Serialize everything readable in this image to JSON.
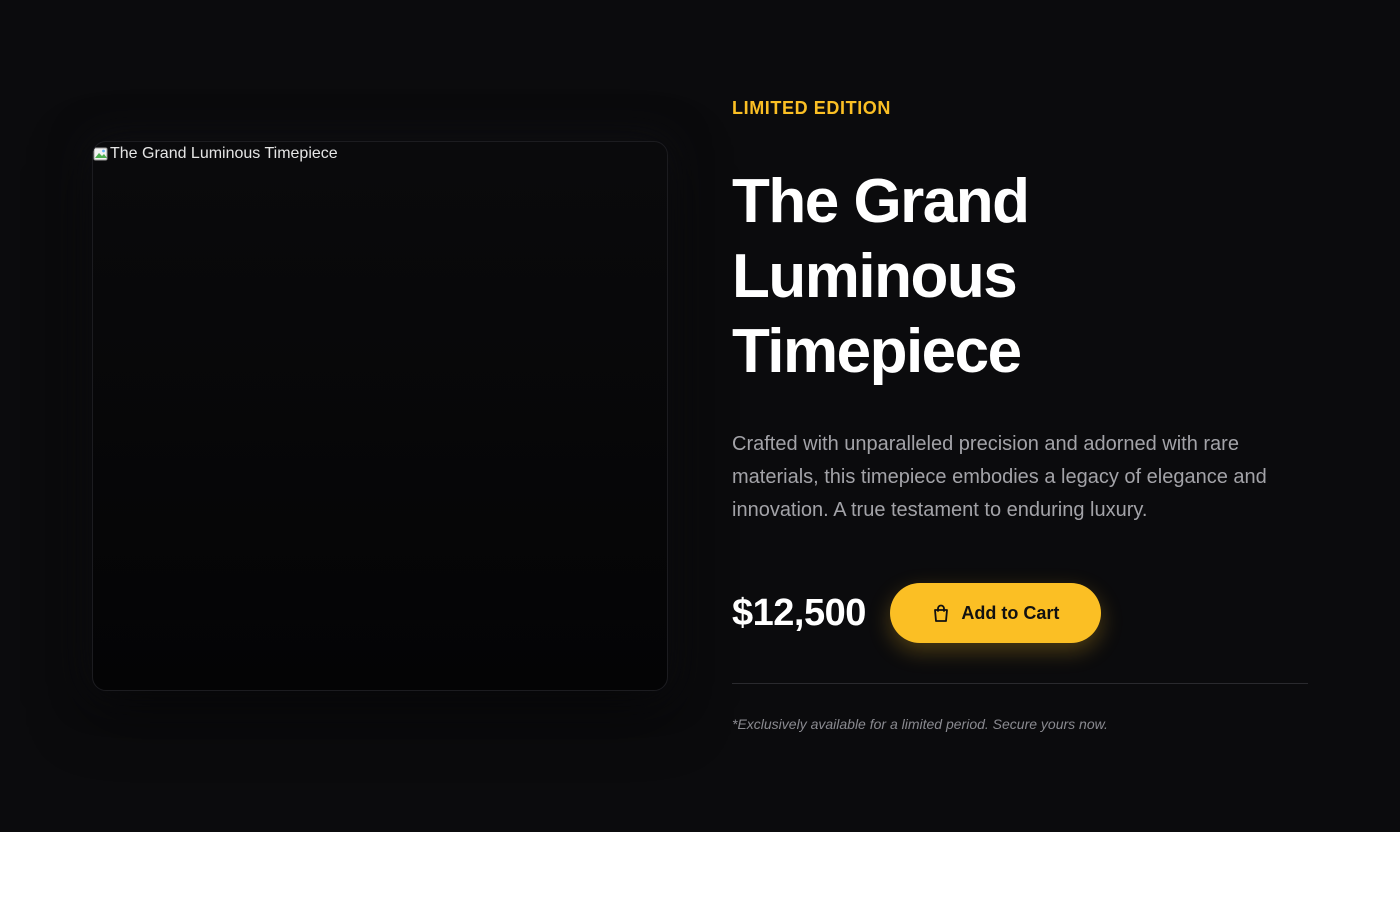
{
  "product": {
    "image_alt": "The Grand Luminous Timepiece",
    "eyebrow": "LIMITED EDITION",
    "title_lines": [
      "The Grand",
      "Luminous",
      "Timepiece"
    ],
    "description_lines": [
      "Crafted with unparalleled precision and adorned with rare",
      "materials, this timepiece embodies a legacy of elegance and",
      "innovation. A true testament to enduring luxury."
    ],
    "price": "$12,500",
    "add_to_cart_label": "Add to Cart",
    "add_to_cart_icon": "shopping-bag-icon",
    "note": "*Exclusively available for a limited period. Secure yours now."
  },
  "colors": {
    "background": "#0b0b0d",
    "accent": "#fbbf24",
    "title": "#ffffff",
    "description": "#a3a3a8",
    "note": "#8a8a90"
  }
}
